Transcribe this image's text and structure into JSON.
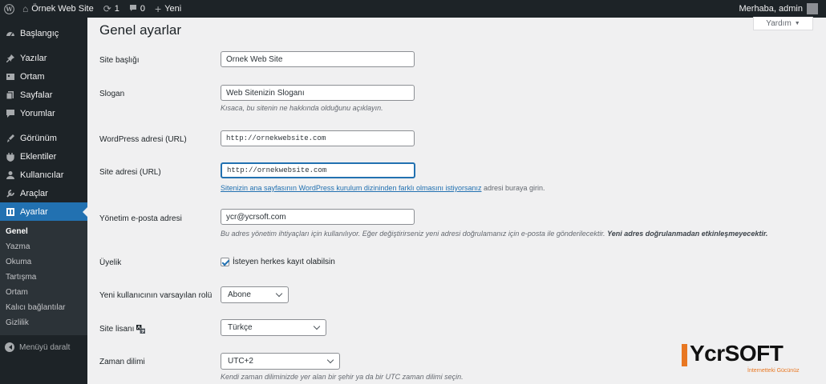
{
  "adminbar": {
    "site_name": "Örnek Web Site",
    "updates_count": "1",
    "comments_count": "0",
    "new_label": "Yeni",
    "greeting": "Merhaba, admin"
  },
  "sidebar": {
    "items": [
      {
        "label": "Başlangıç",
        "icon": "dashboard-icon"
      },
      {
        "label": "Yazılar",
        "icon": "pushpin-icon"
      },
      {
        "label": "Ortam",
        "icon": "media-icon"
      },
      {
        "label": "Sayfalar",
        "icon": "pages-icon"
      },
      {
        "label": "Yorumlar",
        "icon": "comments-icon"
      },
      {
        "label": "Görünüm",
        "icon": "appearance-icon"
      },
      {
        "label": "Eklentiler",
        "icon": "plugins-icon"
      },
      {
        "label": "Kullanıcılar",
        "icon": "users-icon"
      },
      {
        "label": "Araçlar",
        "icon": "tools-icon"
      },
      {
        "label": "Ayarlar",
        "icon": "settings-icon"
      }
    ],
    "submenu": [
      "Genel",
      "Yazma",
      "Okuma",
      "Tartışma",
      "Ortam",
      "Kalıcı bağlantılar",
      "Gizlilik"
    ],
    "collapse_label": "Menüyü daralt"
  },
  "main": {
    "help_label": "Yardım",
    "title": "Genel ayarlar",
    "fields": {
      "site_title": {
        "label": "Site başlığı",
        "value": "Örnek Web Site"
      },
      "tagline": {
        "label": "Slogan",
        "value": "Web Sitenizin Sloganı",
        "description": "Kısaca, bu sitenin ne hakkında olduğunu açıklayın."
      },
      "wp_address": {
        "label": "WordPress adresi (URL)",
        "value": "http://ornekwebsite.com"
      },
      "site_address": {
        "label": "Site adresi (URL)",
        "value": "http://ornekwebsite.com",
        "link_text": "Sitenizin ana sayfasının WordPress kurulum dizininden farklı olmasını istiyorsanız",
        "description_suffix": " adresi buraya girin."
      },
      "admin_email": {
        "label": "Yönetim e-posta adresi",
        "value": "ycr@ycrsoft.com",
        "description": "Bu adres yönetim ihtiyaçları için kullanılıyor. Eğer değiştirirseniz yeni adresi doğrulamanız için e-posta ile gönderilecektir.",
        "description_bold": "Yeni adres doğrulanmadan etkinleşmeyecektir."
      },
      "membership": {
        "label": "Üyelik",
        "checkbox_label": "İsteyen herkes kayıt olabilsin",
        "checked": true
      },
      "default_role": {
        "label": "Yeni kullanıcının varsayılan rolü",
        "selected": "Abone"
      },
      "site_language": {
        "label": "Site lisanı",
        "selected": "Türkçe"
      },
      "timezone": {
        "label": "Zaman dilimi",
        "selected": "UTC+2",
        "description": "Kendi zaman diliminizde yer alan bir şehir ya da bir UTC zaman dilimi seçin."
      }
    }
  },
  "watermark": {
    "brand": "YcrSOFT",
    "tagline": "İnternetteki Gücünüz"
  },
  "colors": {
    "adminbar_bg": "#1d2327",
    "accent": "#2271b1",
    "brand_orange": "#e87722"
  }
}
